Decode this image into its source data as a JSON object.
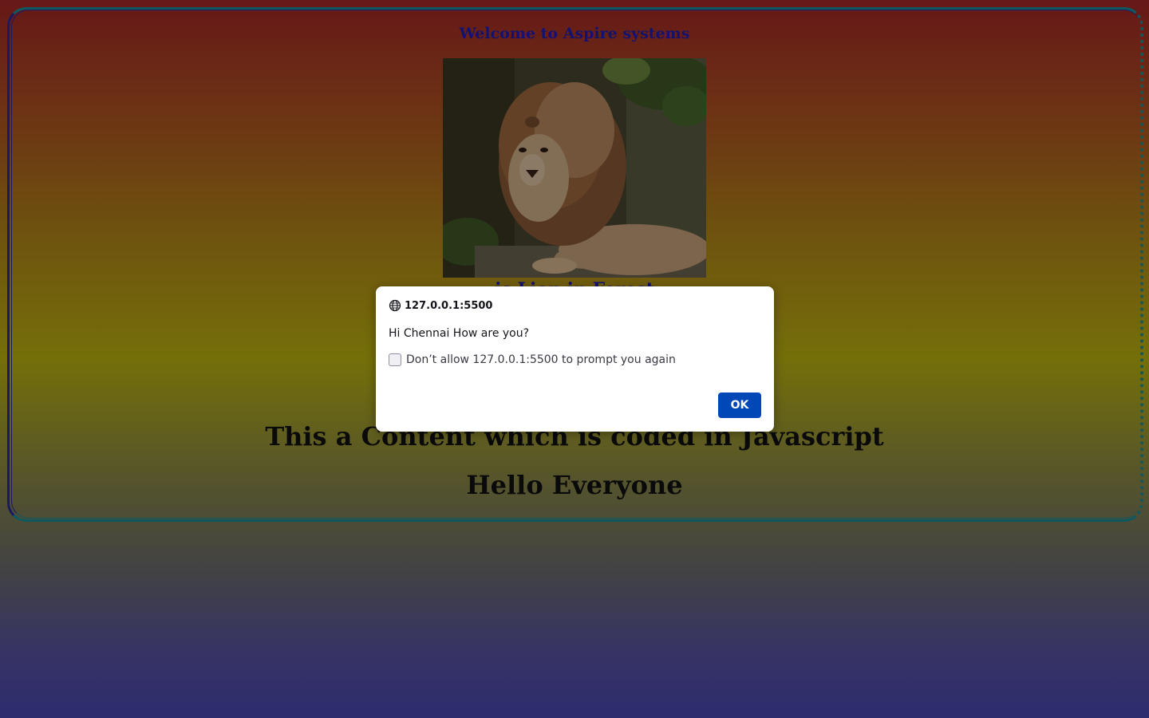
{
  "page": {
    "heading": "Welcome to Aspire systems",
    "image_alt": "lion",
    "image_caption": "is Lion in Forest",
    "content_line": "This a Content which is coded in Javascript",
    "hello_line": "Hello Everyone"
  },
  "dialog": {
    "origin": "127.0.0.1:5500",
    "origin_icon": "globe-icon",
    "message": "Hi Chennai How are you?",
    "checkbox_label": "Don’t allow 127.0.0.1:5500 to prompt you again",
    "checkbox_checked": false,
    "ok_label": "OK"
  },
  "colors": {
    "heading": "#1d1db8",
    "ok_button": "#0048b8",
    "frame_border": "#1b8f9a"
  }
}
